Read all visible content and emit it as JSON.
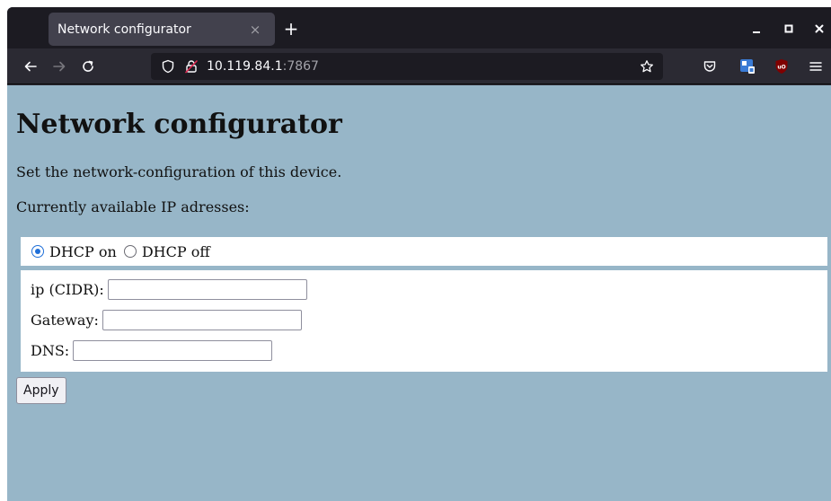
{
  "browser": {
    "tab": {
      "title": "Network configurator",
      "close_glyph": "×"
    },
    "new_tab_glyph": "+",
    "url": {
      "host": "10.119.84.1",
      "port": ":7867"
    },
    "icons": {
      "back": "back-arrow-icon",
      "forward": "forward-arrow-icon",
      "reload": "reload-icon",
      "tracking_protection": "shield-icon",
      "insecure": "insecure-lock-icon",
      "bookmark": "star-icon",
      "pocket": "pocket-icon",
      "extension": "extension-icon",
      "ublock": "ublock-origin-icon",
      "menu": "hamburger-menu-icon"
    }
  },
  "page": {
    "title": "Network configurator",
    "description": "Set the network-configuration of this device.",
    "ip_heading": "Currently available IP adresses:",
    "dhcp": {
      "on_label": "DHCP on",
      "off_label": "DHCP off",
      "selected": "on"
    },
    "fields": [
      {
        "label": "ip (CIDR):",
        "value": ""
      },
      {
        "label": "Gateway:",
        "value": ""
      },
      {
        "label": "DNS:",
        "value": ""
      }
    ],
    "apply_label": "Apply"
  },
  "colors": {
    "page_background": "#97b6c8",
    "chrome_dark": "#1c1b22",
    "toolbar": "#2b2a33",
    "radio_accent": "#1f6fd8",
    "ublock_red": "#800000",
    "extension_blue": "#3a7bd5"
  }
}
